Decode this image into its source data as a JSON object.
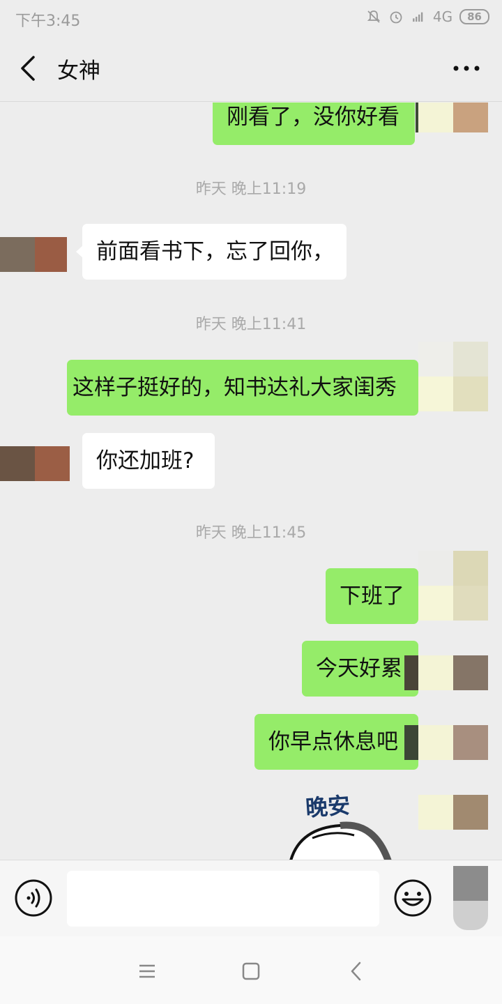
{
  "status_bar": {
    "time": "下午3:45",
    "network": "4G",
    "battery": "86",
    "icons": [
      "mute-bell-icon",
      "alarm-icon",
      "hd-signal-icon",
      "battery-icon"
    ]
  },
  "header": {
    "title": "女神",
    "back_icon": "chevron-left-icon",
    "more_icon": "more-dots-icon"
  },
  "messages": [
    {
      "side": "me",
      "text": "刚看了，没你好看"
    },
    {
      "type": "time",
      "text": "昨天 晚上11:19"
    },
    {
      "side": "them",
      "text": "前面看书下，忘了回你，"
    },
    {
      "type": "time",
      "text": "昨天 晚上11:41"
    },
    {
      "side": "me",
      "text": "这样子挺好的，知书达礼大家闺秀"
    },
    {
      "side": "them",
      "text": "你还加班?"
    },
    {
      "type": "time",
      "text": "昨天 晚上11:45"
    },
    {
      "side": "me",
      "text": "下班了"
    },
    {
      "side": "me",
      "text": "今天好累"
    },
    {
      "side": "me",
      "text": "你早点休息吧"
    },
    {
      "side": "me",
      "type": "sticker",
      "text": "晚安"
    }
  ],
  "input_bar": {
    "voice_icon": "voice-icon",
    "text_value": "",
    "emoji_icon": "emoji-icon"
  },
  "nav_bar": {
    "icons": [
      "menu-icon",
      "home-square-icon",
      "back-triangle-icon"
    ]
  },
  "colors": {
    "background": "#ededed",
    "bubble_me": "#95ec69",
    "bubble_them": "#ffffff",
    "timestamp": "#a9a9a9"
  }
}
